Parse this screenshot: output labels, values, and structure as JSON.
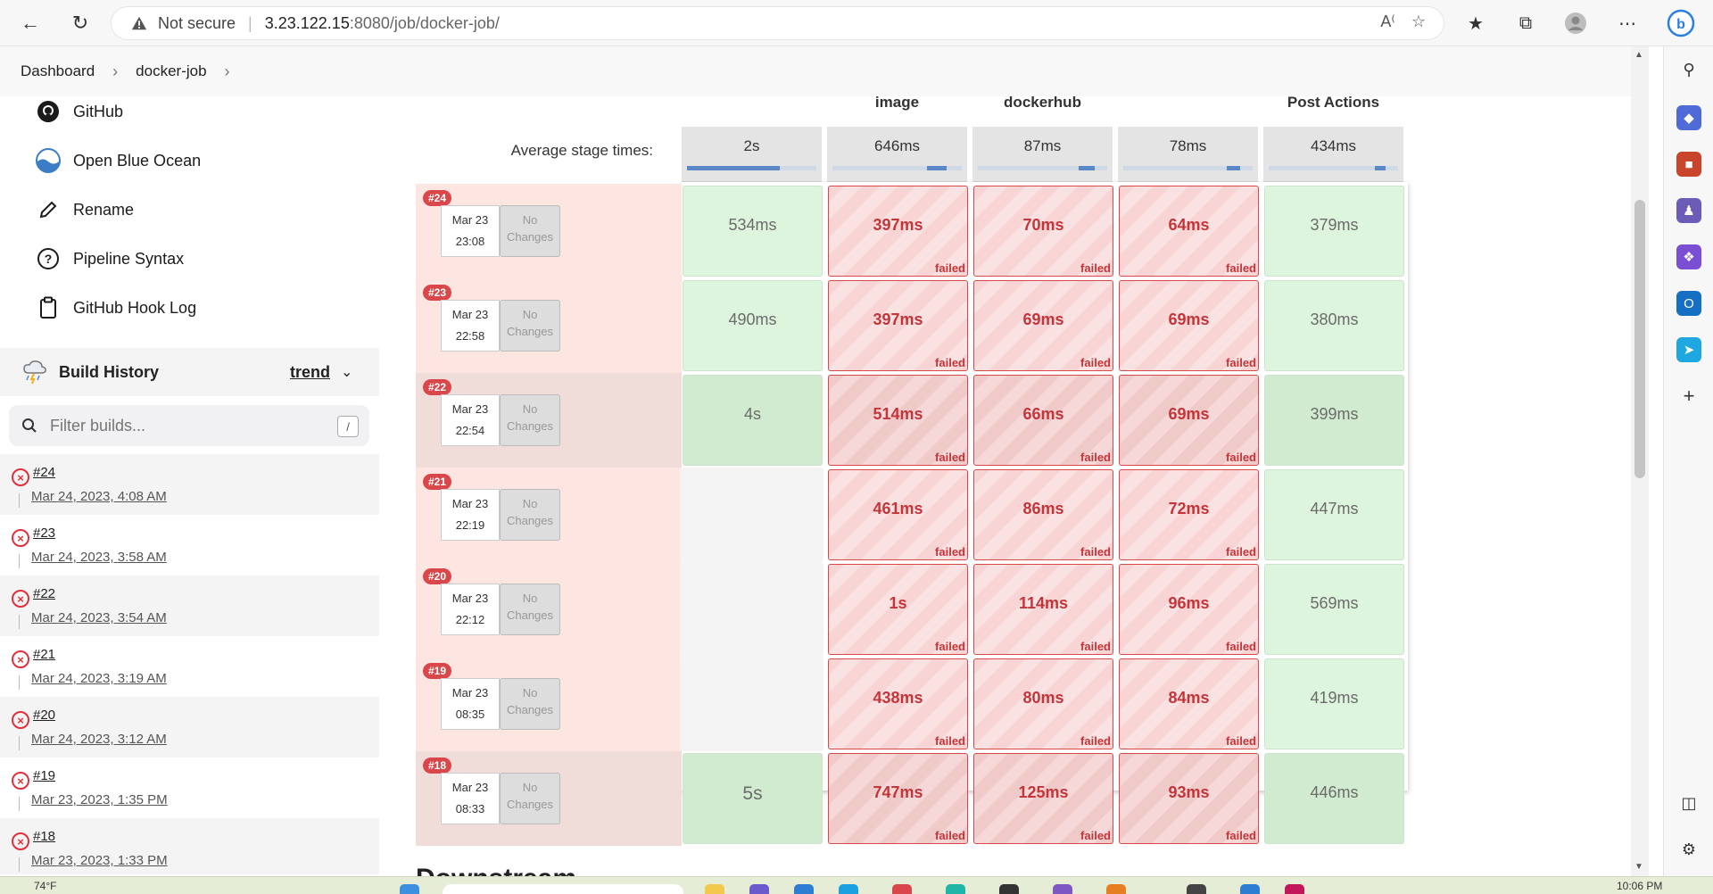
{
  "browser": {
    "security_label": "Not secure",
    "url_host": "3.23.122.15",
    "url_path": ":8080/job/docker-job/"
  },
  "breadcrumb": [
    "Dashboard",
    "docker-job"
  ],
  "sidebar": {
    "tasks": [
      {
        "label": "GitHub",
        "icon": "github-icon"
      },
      {
        "label": "Open Blue Ocean",
        "icon": "blue-ocean-icon"
      },
      {
        "label": "Rename",
        "icon": "pencil-icon"
      },
      {
        "label": "Pipeline Syntax",
        "icon": "help-circle-icon"
      },
      {
        "label": "GitHub Hook Log",
        "icon": "clipboard-icon"
      }
    ],
    "build_history": {
      "title": "Build History",
      "trend_label": "trend",
      "filter_placeholder": "Filter builds...",
      "filter_shortcut": "/",
      "builds": [
        {
          "number": "#24",
          "date": "Mar 24, 2023, 4:08 AM",
          "status": "failed"
        },
        {
          "number": "#23",
          "date": "Mar 24, 2023, 3:58 AM",
          "status": "failed"
        },
        {
          "number": "#22",
          "date": "Mar 24, 2023, 3:54 AM",
          "status": "failed"
        },
        {
          "number": "#21",
          "date": "Mar 24, 2023, 3:19 AM",
          "status": "failed"
        },
        {
          "number": "#20",
          "date": "Mar 24, 2023, 3:12 AM",
          "status": "failed"
        },
        {
          "number": "#19",
          "date": "Mar 23, 2023, 1:35 PM",
          "status": "failed"
        },
        {
          "number": "#18",
          "date": "Mar 23, 2023, 1:33 PM",
          "status": "failed"
        }
      ]
    }
  },
  "stage_view": {
    "stage_headers": [
      "",
      "image",
      "dockerhub",
      "",
      "Post Actions"
    ],
    "avg_label": "Average stage times:",
    "avg_times": [
      "2s",
      "646ms",
      "87ms",
      "78ms",
      "434ms"
    ],
    "avg_fill_pct": [
      72,
      15,
      12,
      10,
      8
    ],
    "no_changes_line1": "No",
    "no_changes_line2": "Changes",
    "failed_tag": "failed",
    "runs": [
      {
        "badge": "#24",
        "date": "Mar 23",
        "time": "23:08",
        "cells": [
          {
            "v": "534ms",
            "s": "ok"
          },
          {
            "v": "397ms",
            "s": "fail"
          },
          {
            "v": "70ms",
            "s": "fail"
          },
          {
            "v": "64ms",
            "s": "fail"
          },
          {
            "v": "379ms",
            "s": "ok"
          }
        ]
      },
      {
        "badge": "#23",
        "date": "Mar 23",
        "time": "22:58",
        "cells": [
          {
            "v": "490ms",
            "s": "ok"
          },
          {
            "v": "397ms",
            "s": "fail"
          },
          {
            "v": "69ms",
            "s": "fail"
          },
          {
            "v": "69ms",
            "s": "fail"
          },
          {
            "v": "380ms",
            "s": "ok"
          }
        ]
      },
      {
        "badge": "#22",
        "date": "Mar 23",
        "time": "22:54",
        "cells": [
          {
            "v": "4s",
            "s": "ok"
          },
          {
            "v": "514ms",
            "s": "fail"
          },
          {
            "v": "66ms",
            "s": "fail"
          },
          {
            "v": "69ms",
            "s": "fail"
          },
          {
            "v": "399ms",
            "s": "ok"
          }
        ]
      },
      {
        "badge": "#21",
        "date": "Mar 23",
        "time": "22:19",
        "cells": [
          {
            "v": "",
            "s": "empty"
          },
          {
            "v": "461ms",
            "s": "fail"
          },
          {
            "v": "86ms",
            "s": "fail"
          },
          {
            "v": "72ms",
            "s": "fail"
          },
          {
            "v": "447ms",
            "s": "ok"
          }
        ]
      },
      {
        "badge": "#20",
        "date": "Mar 23",
        "time": "22:12",
        "cells": [
          {
            "v": "",
            "s": "empty"
          },
          {
            "v": "1s",
            "s": "fail"
          },
          {
            "v": "114ms",
            "s": "fail"
          },
          {
            "v": "96ms",
            "s": "fail"
          },
          {
            "v": "569ms",
            "s": "ok"
          }
        ]
      },
      {
        "badge": "#19",
        "date": "Mar 23",
        "time": "08:35",
        "cells": [
          {
            "v": "",
            "s": "empty"
          },
          {
            "v": "438ms",
            "s": "fail"
          },
          {
            "v": "80ms",
            "s": "fail"
          },
          {
            "v": "84ms",
            "s": "fail"
          },
          {
            "v": "419ms",
            "s": "ok"
          }
        ]
      },
      {
        "badge": "#18",
        "date": "Mar 23",
        "time": "08:33",
        "cells": [
          {
            "v": "5s",
            "s": "ok"
          },
          {
            "v": "747ms",
            "s": "fail"
          },
          {
            "v": "125ms",
            "s": "fail"
          },
          {
            "v": "93ms",
            "s": "fail"
          },
          {
            "v": "446ms",
            "s": "ok"
          }
        ]
      }
    ]
  },
  "downstream_heading": "Downstream",
  "taskbar": {
    "weather": "74°F",
    "clock": "10:06 PM"
  },
  "colors": {
    "failed_red": "#d9474a",
    "success_green": "#ddf5dc",
    "avg_bar_blue": "#5a87c5"
  }
}
